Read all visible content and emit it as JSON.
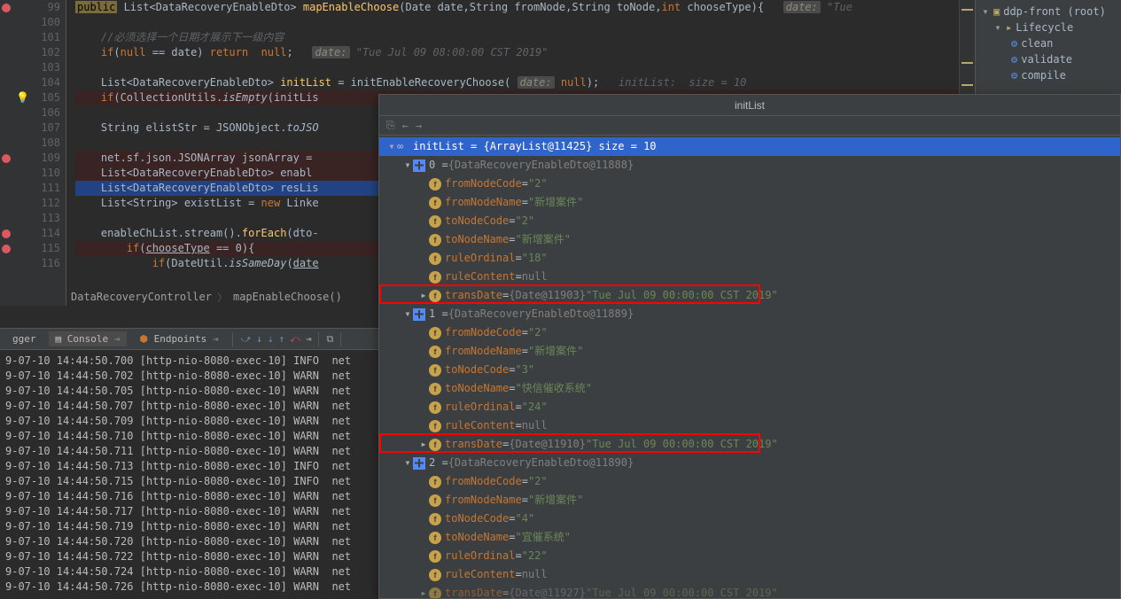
{
  "editor": {
    "lines": [
      {
        "num": "99",
        "bp": true,
        "html": "<span class='public-hl'>public</span> List&lt;DataRecoveryEnableDto&gt; <span class='method'>mapEnableChoose</span>(Date date,String fromNode,String toNode,<span class='kw'>int</span> chooseType){   <span class='hintbg'>date:</span> <span class='hint'>\"Tue </span>"
      },
      {
        "num": "100",
        "html": ""
      },
      {
        "num": "101",
        "html": "    <span class='hint'>//必须选择一个日期才展示下一级内容</span>"
      },
      {
        "num": "102",
        "html": "    <span class='kw'>if</span>(<span class='kw'>null</span> == date) <span class='kw'>return</span>  <span class='kw'>null</span>;   <span class='hintbg'>date:</span> <span class='hint'>\"Tue Jul 09 08:00:00 CST 2019\"</span>"
      },
      {
        "num": "103",
        "html": ""
      },
      {
        "num": "104",
        "html": "    List&lt;DataRecoveryEnableDto&gt; <span class='method'>initList</span> = initEnableRecoveryChoose( <span class='hintbg'>date:</span> <span class='kw'>null</span>);   <span class='hint'>initList:  size = 10</span>"
      },
      {
        "num": "105",
        "bulb": true,
        "cls": "hl-brown",
        "html": "    <span class='kw'>if</span>(CollectionUtils.<span style='font-style:italic'>isEmpty</span>(initLis"
      },
      {
        "num": "106",
        "html": ""
      },
      {
        "num": "107",
        "html": "    String elistStr = JSONObject.<span style='font-style:italic'>toJSO</span>"
      },
      {
        "num": "108",
        "html": ""
      },
      {
        "num": "109",
        "bp": true,
        "cls": "hl-brown",
        "html": "    net.sf.json.JSONArray jsonArray = "
      },
      {
        "num": "110",
        "cls": "hl-brown",
        "html": "    List&lt;DataRecoveryEnableDto&gt; enabl"
      },
      {
        "num": "111",
        "cls": "hl-blue",
        "html": "    List&lt;DataRecoveryEnableDto&gt; resLis"
      },
      {
        "num": "112",
        "html": "    List&lt;String&gt; existList = <span class='kw'>new</span> Linke"
      },
      {
        "num": "113",
        "html": ""
      },
      {
        "num": "114",
        "bp": true,
        "html": "    enableChList.stream().<span class='method'>forEach</span>(dto-"
      },
      {
        "num": "115",
        "bp": true,
        "cls": "hl-brown",
        "html": "        <span class='kw'>if</span>(<span class='ul'>chooseType</span> == 0){"
      },
      {
        "num": "116",
        "html": "            <span class='kw'>if</span>(DateUtil.<span style='font-style:italic'>isSameDay</span>(<span class='ul'>date</span>"
      }
    ],
    "breadcrumb1": "DataRecoveryController",
    "breadcrumb2": "mapEnableChoose()"
  },
  "rightPanel": {
    "root": "ddp-front (root)",
    "lifecycle": "Lifecycle",
    "items": [
      "clean",
      "validate",
      "compile"
    ]
  },
  "bottom": {
    "tab_logger": "gger",
    "tab_console": "Console",
    "tab_endpoints": "Endpoints",
    "logs": [
      "9-07-10 14:44:50.700 [http-nio-8080-exec-10] INFO  net",
      "9-07-10 14:44:50.702 [http-nio-8080-exec-10] WARN  net",
      "9-07-10 14:44:50.705 [http-nio-8080-exec-10] WARN  net",
      "9-07-10 14:44:50.707 [http-nio-8080-exec-10] WARN  net",
      "9-07-10 14:44:50.709 [http-nio-8080-exec-10] WARN  net",
      "9-07-10 14:44:50.710 [http-nio-8080-exec-10] WARN  net",
      "9-07-10 14:44:50.711 [http-nio-8080-exec-10] WARN  net",
      "9-07-10 14:44:50.713 [http-nio-8080-exec-10] INFO  net",
      "9-07-10 14:44:50.715 [http-nio-8080-exec-10] INFO  net",
      "9-07-10 14:44:50.716 [http-nio-8080-exec-10] WARN  net",
      "9-07-10 14:44:50.717 [http-nio-8080-exec-10] WARN  net",
      "9-07-10 14:44:50.719 [http-nio-8080-exec-10] WARN  net",
      "9-07-10 14:44:50.720 [http-nio-8080-exec-10] WARN  net",
      "9-07-10 14:44:50.722 [http-nio-8080-exec-10] WARN  net",
      "9-07-10 14:44:50.724 [http-nio-8080-exec-10] WARN  net",
      "9-07-10 14:44:50.726 [http-nio-8080-exec-10] WARN  net"
    ]
  },
  "debug": {
    "title": "initList",
    "root": "initList = {ArrayList@11425}  size = 10",
    "items": [
      {
        "idx": "0",
        "ref": "{DataRecoveryEnableDto@11888}",
        "fields": [
          {
            "n": "fromNodeCode",
            "v": "\"2\"",
            "t": "str"
          },
          {
            "n": "fromNodeName",
            "v": "\"新增案件\"",
            "t": "str"
          },
          {
            "n": "toNodeCode",
            "v": "\"2\"",
            "t": "str"
          },
          {
            "n": "toNodeName",
            "v": "\"新增案件\"",
            "t": "str"
          },
          {
            "n": "ruleOrdinal",
            "v": "\"18\"",
            "t": "str"
          },
          {
            "n": "ruleContent",
            "v": "null",
            "t": "null"
          },
          {
            "n": "transDate",
            "ref": "{Date@11903}",
            "v": "\"Tue Jul 09 00:00:00 CST 2019\"",
            "t": "obj",
            "hl": true,
            "arrow": true
          }
        ]
      },
      {
        "idx": "1",
        "ref": "{DataRecoveryEnableDto@11889}",
        "fields": [
          {
            "n": "fromNodeCode",
            "v": "\"2\"",
            "t": "str"
          },
          {
            "n": "fromNodeName",
            "v": "\"新增案件\"",
            "t": "str"
          },
          {
            "n": "toNodeCode",
            "v": "\"3\"",
            "t": "str"
          },
          {
            "n": "toNodeName",
            "v": "\"快信催收系统\"",
            "t": "str"
          },
          {
            "n": "ruleOrdinal",
            "v": "\"24\"",
            "t": "str"
          },
          {
            "n": "ruleContent",
            "v": "null",
            "t": "null"
          },
          {
            "n": "transDate",
            "ref": "{Date@11910}",
            "v": "\"Tue Jul 09 00:00:00 CST 2019\"",
            "t": "obj",
            "hl": true,
            "arrow": true
          }
        ]
      },
      {
        "idx": "2",
        "ref": "{DataRecoveryEnableDto@11890}",
        "fields": [
          {
            "n": "fromNodeCode",
            "v": "\"2\"",
            "t": "str"
          },
          {
            "n": "fromNodeName",
            "v": "\"新增案件\"",
            "t": "str"
          },
          {
            "n": "toNodeCode",
            "v": "\"4\"",
            "t": "str"
          },
          {
            "n": "toNodeName",
            "v": "\"宜催系统\"",
            "t": "str"
          },
          {
            "n": "ruleOrdinal",
            "v": "\"22\"",
            "t": "str"
          },
          {
            "n": "ruleContent",
            "v": "null",
            "t": "null"
          },
          {
            "n": "transDate",
            "ref": "{Date@11927}",
            "v": "\"Tue Jul 09 00:00:00 CST 2019\"",
            "t": "obj",
            "arrow": true,
            "cut": true
          }
        ]
      }
    ]
  }
}
